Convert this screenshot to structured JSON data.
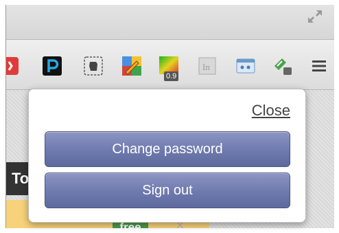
{
  "extension_popup": {
    "close_label": "Close",
    "buttons": [
      {
        "label": "Change password"
      },
      {
        "label": "Sign out"
      }
    ]
  },
  "toolbar": {
    "icons": [
      "extension-red-icon",
      "pocket-icon",
      "evernote-icon",
      "pencil-icon",
      "color-grid-icon",
      "linkedin-icon",
      "window-icon",
      "tag-icon",
      "menu-icon"
    ],
    "badge_text": "0.9"
  },
  "background": {
    "dark_strip_text": "To",
    "free_badge": "free",
    "dismiss_mark": "×"
  }
}
